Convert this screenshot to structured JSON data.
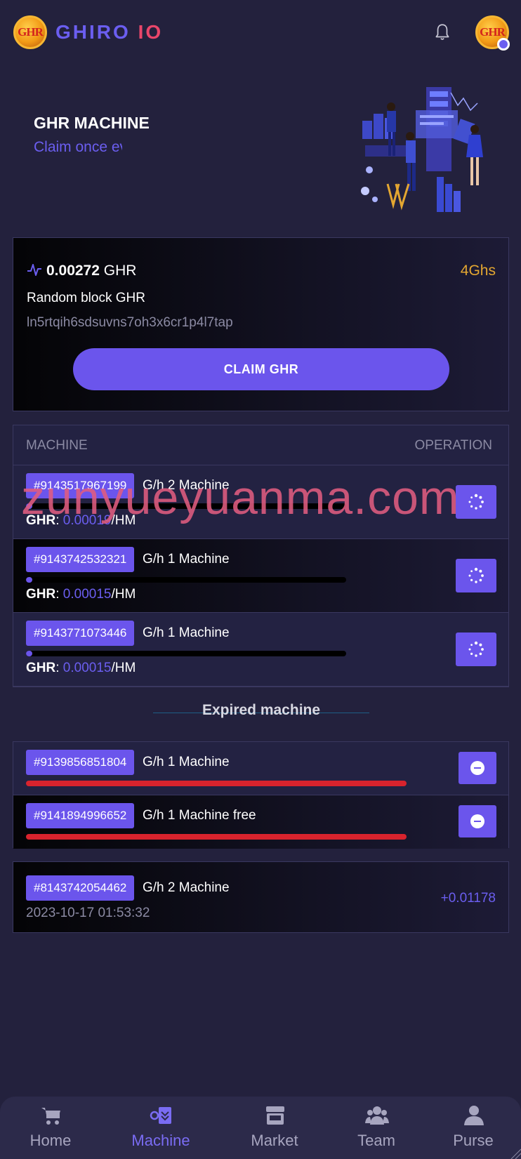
{
  "header": {
    "logo_text": "GHR",
    "brand_part1": "GHIRO",
    "brand_part2": "IO",
    "avatar_text": "GHR",
    "icons": [
      "bell-icon"
    ]
  },
  "hero": {
    "title": "GHR MACHINE",
    "subtitle": "Claim once every"
  },
  "claim": {
    "amount_value": "0.00272",
    "amount_unit": "GHR",
    "speed": "4Ghs",
    "random_label": "Random block GHR",
    "hash": "ln5rtqih6sdsuvns7oh3x6cr1p4l7tap",
    "button_label": "CLAIM GHR"
  },
  "machine_table": {
    "col_machine": "MACHINE",
    "col_operation": "OPERATION",
    "rows": [
      {
        "id": "#9143517967199",
        "name": "G/h 2 Machine",
        "ghr_label": "GHR",
        "rate": "0.00019",
        "rate_unit": "/HM",
        "progress_fraction": 0.02
      },
      {
        "id": "#9143742532321",
        "name": "G/h 1 Machine",
        "ghr_label": "GHR",
        "rate": "0.00015",
        "rate_unit": "/HM",
        "progress_fraction": 0.02
      },
      {
        "id": "#9143771073446",
        "name": "G/h 1 Machine",
        "ghr_label": "GHR",
        "rate": "0.00015",
        "rate_unit": "/HM",
        "progress_fraction": 0.02
      }
    ]
  },
  "expired": {
    "title": "Expired machine",
    "rows": [
      {
        "id": "#9139856851804",
        "name": "G/h 1 Machine"
      },
      {
        "id": "#9141894996652",
        "name": "G/h 1 Machine free"
      }
    ]
  },
  "record": {
    "id": "#8143742054462",
    "name": "G/h 2 Machine",
    "date": "2023-10-17 01:53:32",
    "amount": "+0.01178"
  },
  "watermark": "zunyueyuanma.com",
  "nav": {
    "items": [
      {
        "label": "Home",
        "icon": "cart-icon"
      },
      {
        "label": "Machine",
        "icon": "machine-icon"
      },
      {
        "label": "Market",
        "icon": "store-icon"
      },
      {
        "label": "Team",
        "icon": "team-icon"
      },
      {
        "label": "Purse",
        "icon": "user-icon"
      }
    ],
    "active": "Machine"
  },
  "colors": {
    "accent": "#6b55ec",
    "speed": "#e4a731",
    "expired_bar": "#d8232d",
    "background": "#23213d"
  }
}
